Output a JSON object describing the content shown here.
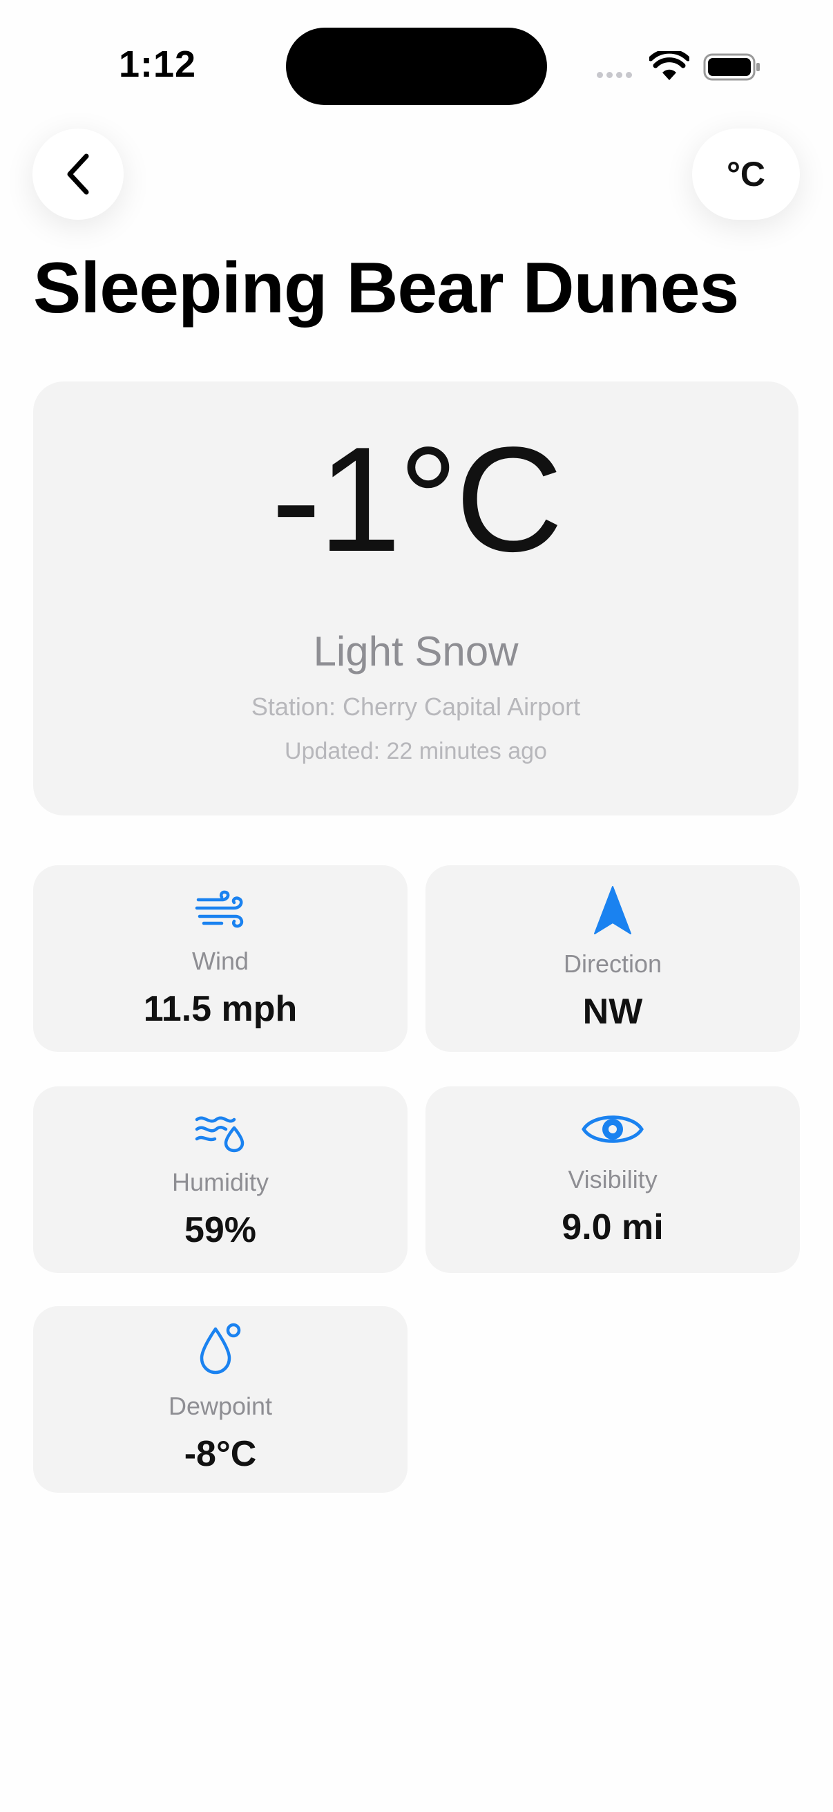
{
  "status_bar": {
    "time": "1:12"
  },
  "nav": {
    "back_icon": "chevron-left-icon",
    "unit_toggle_label": "°C"
  },
  "location_name": "Sleeping Bear Dunes",
  "current": {
    "temperature": "-1°C",
    "condition": "Light Snow",
    "station": "Station: Cherry Capital Airport",
    "updated": "Updated: 22 minutes ago"
  },
  "metrics": {
    "wind": {
      "icon": "wind-icon",
      "label": "Wind",
      "value": "11.5 mph"
    },
    "direction": {
      "icon": "location-arrow-icon",
      "label": "Direction",
      "value": "NW"
    },
    "humidity": {
      "icon": "humidity-icon",
      "label": "Humidity",
      "value": "59%"
    },
    "visibility": {
      "icon": "eye-icon",
      "label": "Visibility",
      "value": "9.0 mi"
    },
    "dewpoint": {
      "icon": "dewpoint-drop-icon",
      "label": "Dewpoint",
      "value": "-8°C"
    }
  },
  "colors": {
    "accent": "#1a82f0",
    "card_background": "#f3f3f3",
    "secondary_text": "#8e8e93",
    "tertiary_text": "#b7b7bb"
  }
}
